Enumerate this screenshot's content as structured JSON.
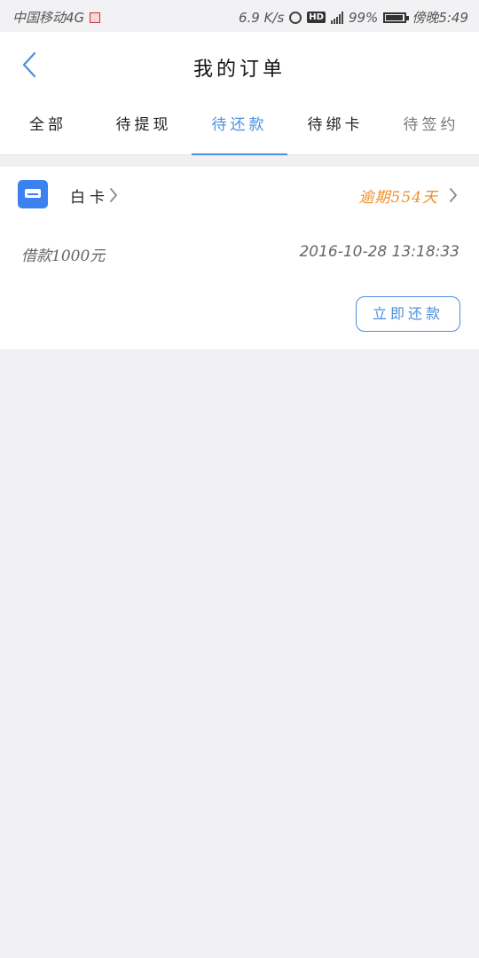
{
  "status_bar": {
    "carrier": "中国移动4G",
    "speed": "6.9 K/s",
    "hd_label": "HD",
    "battery": "99%",
    "time": "傍晚5:49"
  },
  "header": {
    "title": "我的订单",
    "back_icon": "chevron-left-icon"
  },
  "tabs": [
    {
      "label": "全部",
      "active": false
    },
    {
      "label": "待提现",
      "active": false
    },
    {
      "label": "待还款",
      "active": true
    },
    {
      "label": "待绑卡",
      "active": false
    },
    {
      "label": "待签约",
      "active": false
    }
  ],
  "order": {
    "product_name": "白卡",
    "overdue": "逾期554天",
    "loan_amount": "借款1000元",
    "datetime": "2016-10-28 13:18:33",
    "repay_button": "立即还款"
  },
  "colors": {
    "accent": "#4a8fe0",
    "overdue": "#f0902a",
    "card_icon": "#3b82f0",
    "background": "#f0f0f2"
  }
}
